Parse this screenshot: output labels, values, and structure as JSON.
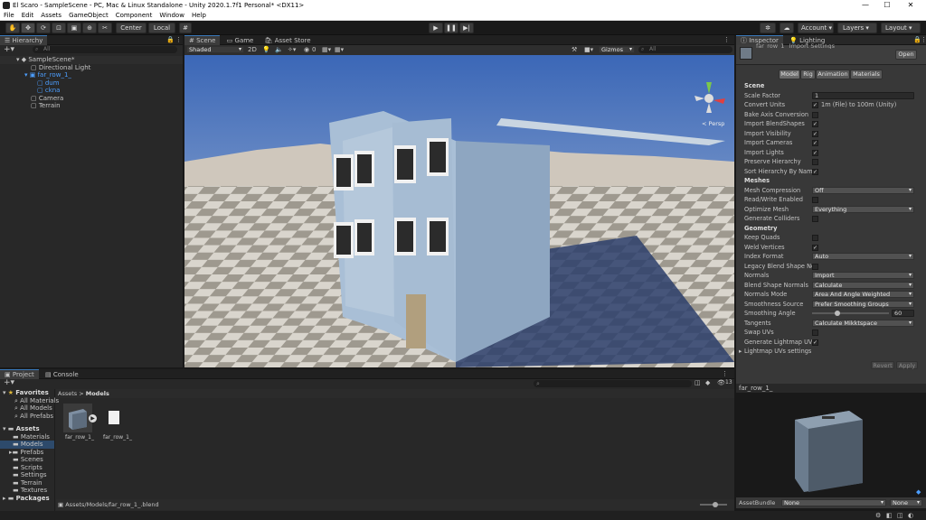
{
  "window": {
    "title": "El Scaro - SampleScene - PC, Mac & Linux Standalone - Unity 2020.1.7f1 Personal* <DX11>",
    "minimize": "—",
    "maximize": "☐",
    "close": "✕"
  },
  "menu": [
    "File",
    "Edit",
    "Assets",
    "GameObject",
    "Component",
    "Window",
    "Help"
  ],
  "toolbar": {
    "pivot": "Center",
    "space": "Local",
    "account": "Account",
    "layers": "Layers",
    "layout": "Layout"
  },
  "hierarchy": {
    "tab": "Hierarchy",
    "search": "All",
    "scene": "SampleScene*",
    "items": [
      "Directional Light",
      "far_row_1_",
      "dum",
      "ckna",
      "Camera",
      "Terrain"
    ]
  },
  "sceneview": {
    "tabs": [
      "Scene",
      "Game",
      "Asset Store"
    ],
    "shading": "Shaded",
    "mode2d": "2D",
    "fx_count": "0",
    "gizmos": "Gizmos",
    "search": "All",
    "persp": "< Persp"
  },
  "inspector": {
    "tabs": [
      "Inspector",
      "Lighting"
    ],
    "asset_name": "far_row_1_ Import Settings",
    "open": "Open",
    "subtabs": [
      "Model",
      "Rig",
      "Animation",
      "Materials"
    ],
    "scene_header": "Scene",
    "rows": [
      {
        "label": "Scale Factor",
        "type": "field",
        "value": "1"
      },
      {
        "label": "Convert Units",
        "type": "check",
        "checked": true,
        "value": "1m (File) to 100m (Unity)"
      },
      {
        "label": "Bake Axis Conversion",
        "type": "check",
        "checked": false
      },
      {
        "label": "Import BlendShapes",
        "type": "check",
        "checked": true
      },
      {
        "label": "Import Visibility",
        "type": "check",
        "checked": true
      },
      {
        "label": "Import Cameras",
        "type": "check",
        "checked": true
      },
      {
        "label": "Import Lights",
        "type": "check",
        "checked": true
      },
      {
        "label": "Preserve Hierarchy",
        "type": "check",
        "checked": false
      },
      {
        "label": "Sort Hierarchy By Name",
        "type": "check",
        "checked": true
      },
      {
        "label": "Meshes",
        "type": "header"
      },
      {
        "label": "Mesh Compression",
        "type": "dropdown",
        "value": "Off"
      },
      {
        "label": "Read/Write Enabled",
        "type": "check",
        "checked": false
      },
      {
        "label": "Optimize Mesh",
        "type": "dropdown",
        "value": "Everything"
      },
      {
        "label": "Generate Colliders",
        "type": "check",
        "checked": false
      },
      {
        "label": "Geometry",
        "type": "header"
      },
      {
        "label": "Keep Quads",
        "type": "check",
        "checked": false
      },
      {
        "label": "Weld Vertices",
        "type": "check",
        "checked": true
      },
      {
        "label": "Index Format",
        "type": "dropdown",
        "value": "Auto"
      },
      {
        "label": "Legacy Blend Shape No",
        "type": "check",
        "checked": false
      },
      {
        "label": "Normals",
        "type": "dropdown",
        "value": "Import"
      },
      {
        "label": "Blend Shape Normals",
        "type": "dropdown",
        "value": "Calculate"
      },
      {
        "label": "Normals Mode",
        "type": "dropdown",
        "value": "Area And Angle Weighted"
      },
      {
        "label": "Smoothness Source",
        "type": "dropdown",
        "value": "Prefer Smoothing Groups"
      },
      {
        "label": "Smoothing Angle",
        "type": "slider",
        "value": "60",
        "fraction": 0.33
      },
      {
        "label": "Tangents",
        "type": "dropdown",
        "value": "Calculate Mikktspace"
      },
      {
        "label": "Swap UVs",
        "type": "check",
        "checked": false
      },
      {
        "label": "Generate Lightmap UVs",
        "type": "check",
        "checked": true
      },
      {
        "label": "Lightmap UVs settings",
        "type": "fold"
      }
    ],
    "revert": "Revert",
    "apply": "Apply",
    "preview_name": "far_row_1_",
    "assetbundle_label": "AssetBundle",
    "assetbundle_value": "None",
    "assetbundle_variant": "None"
  },
  "project": {
    "tabs": [
      "Project",
      "Console"
    ],
    "hidden_count": "13",
    "breadcrumb": [
      "Assets",
      "Models"
    ],
    "favorites_label": "Favorites",
    "favorites": [
      "All Materials",
      "All Models",
      "All Prefabs"
    ],
    "assets_label": "Assets",
    "folders": [
      "Materials",
      "Models",
      "Prefabs",
      "Scenes",
      "Scripts",
      "Settings",
      "Terrain",
      "Textures"
    ],
    "packages_label": "Packages",
    "files": [
      "far_row_1_",
      "far_row_1_"
    ],
    "status_path": "Assets/Models/far_row_1_.blend"
  }
}
